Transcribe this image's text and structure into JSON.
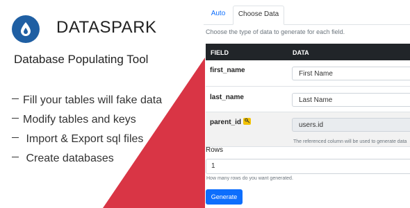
{
  "brand": {
    "name": "DATASPARK",
    "tagline": "Database Populating Tool",
    "logo_icon": "flame-drop-icon",
    "logo_color": "#1f5fa3"
  },
  "features": [
    "Fill your tables will fake data",
    "Modify tables and keys",
    " Import & Export sql files",
    " Create databases"
  ],
  "accent": {
    "red": "#d93545",
    "blue": "#0d6efd"
  },
  "tabs": [
    {
      "label": "Auto",
      "active": false
    },
    {
      "label": "Choose Data",
      "active": true
    }
  ],
  "choose": {
    "hint": "Choose the type of data to generate for each field.",
    "header": {
      "field": "FIELD",
      "data": "DATA"
    },
    "rows": [
      {
        "field": "first_name",
        "value": "First Name"
      },
      {
        "field": "last_name",
        "value": "Last Name"
      },
      {
        "field": "parent_id",
        "value": "users.id",
        "icon": "key-icon",
        "note": "The referenced column will be used to generate data"
      }
    ]
  },
  "rows_field": {
    "label": "Rows",
    "value": "1",
    "hint": "How many rows do you want generated."
  },
  "generate_label": "Generate"
}
